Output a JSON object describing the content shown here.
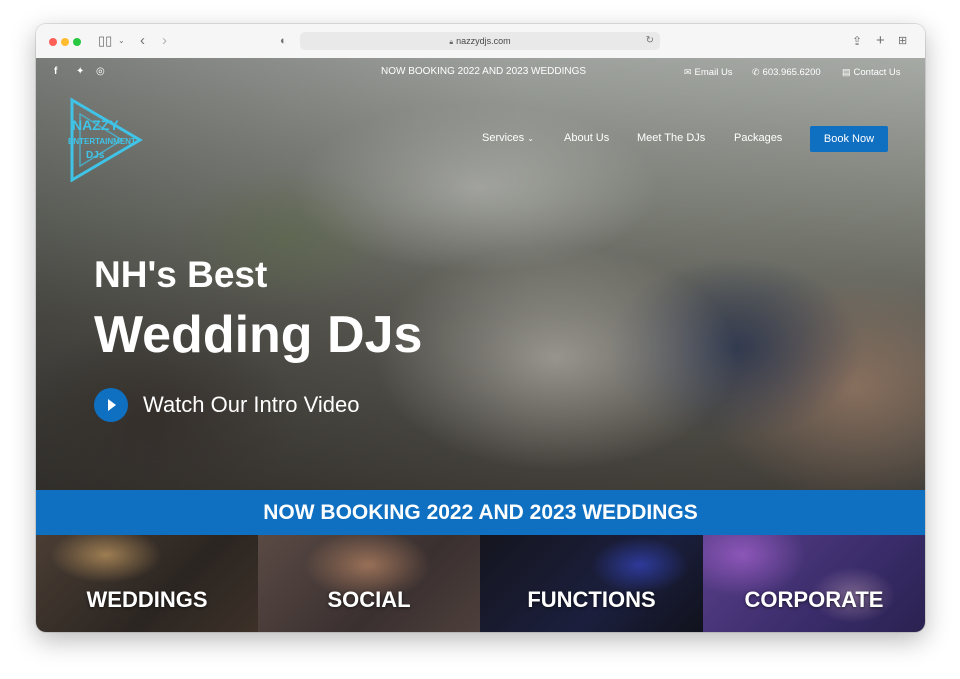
{
  "browser": {
    "url": "nazzydjs.com"
  },
  "topbar": {
    "notice": "NOW BOOKING 2022 AND 2023 WEDDINGS",
    "email_label": "Email Us",
    "phone": "603.965.6200",
    "contact_label": "Contact Us"
  },
  "nav": {
    "items": [
      {
        "label": "Services"
      },
      {
        "label": "About Us"
      },
      {
        "label": "Meet The DJs"
      },
      {
        "label": "Packages"
      }
    ],
    "cta_label": "Book Now"
  },
  "logo": {
    "line1": "NAZZY",
    "line2": "ENTERTAINMENT",
    "line3": "DJs"
  },
  "hero": {
    "headline_small": "NH's Best",
    "headline_large": "Wedding DJs",
    "video_label": "Watch Our Intro Video"
  },
  "banner": {
    "text": "NOW BOOKING 2022 AND 2023 WEDDINGS"
  },
  "categories": [
    {
      "label": "WEDDINGS"
    },
    {
      "label": "SOCIAL"
    },
    {
      "label": "FUNCTIONS"
    },
    {
      "label": "CORPORATE"
    }
  ],
  "colors": {
    "accent": "#0f6fc1",
    "logo_cyan": "#3fc4e8"
  }
}
